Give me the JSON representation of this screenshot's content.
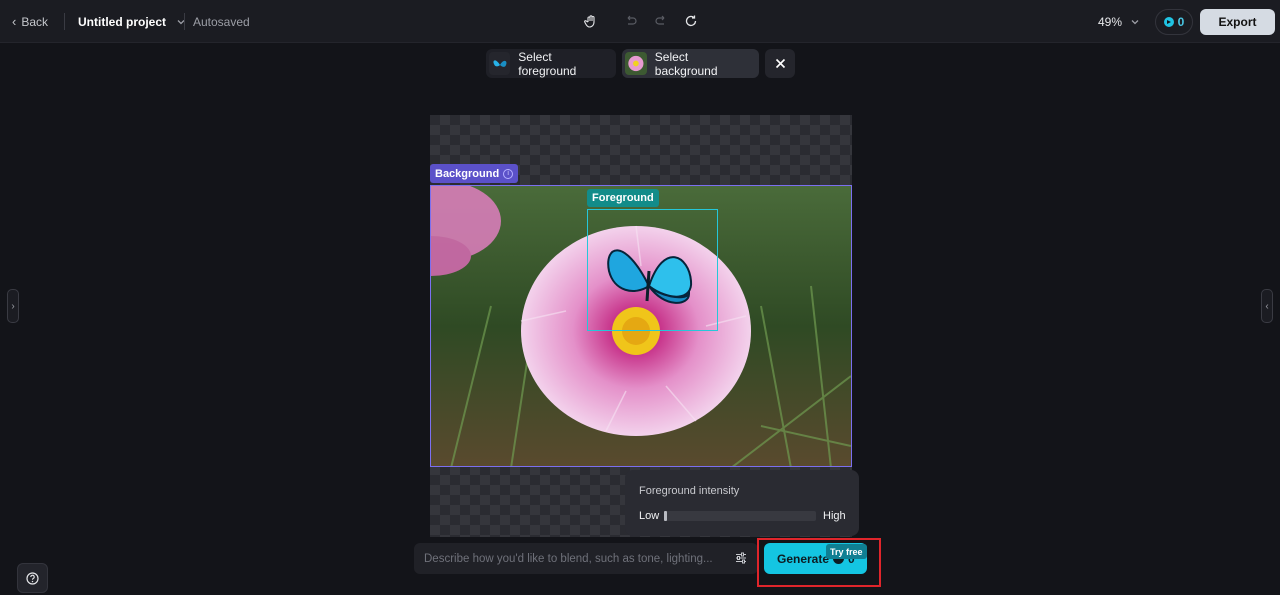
{
  "topbar": {
    "back_label": "Back",
    "project_name": "Untitled project",
    "save_status": "Autosaved",
    "zoom_value": "49%",
    "credits": "0",
    "export_label": "Export"
  },
  "selection_bar": {
    "foreground_label": "Select foreground",
    "background_label": "Select background"
  },
  "canvas": {
    "background_tag": "Background",
    "foreground_tag": "Foreground"
  },
  "intensity_panel": {
    "title": "Foreground intensity",
    "low_label": "Low",
    "high_label": "High",
    "value": 0.0
  },
  "prompt": {
    "placeholder": "Describe how you'd like to blend, such as tone, lighting..."
  },
  "generate": {
    "label": "Generate",
    "cost": "0",
    "badge": "Try free"
  },
  "colors": {
    "accent": "#14c5e2",
    "background_frame": "#7b6ff0",
    "foreground_frame": "#25c7d9",
    "highlight": "#e0252b"
  }
}
